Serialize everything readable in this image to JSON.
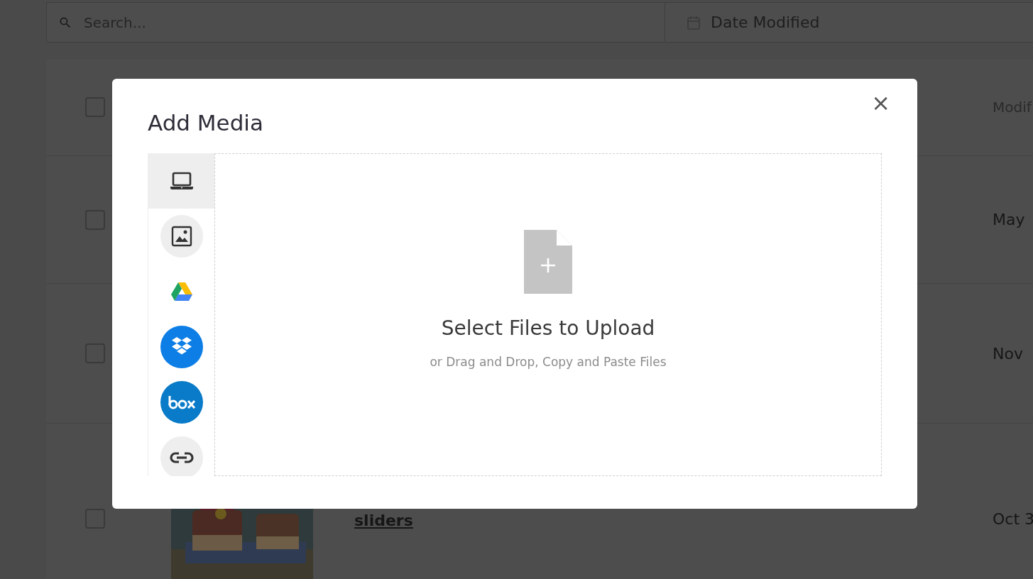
{
  "search": {
    "placeholder": "Search..."
  },
  "date_filter": {
    "label": "Date Modified"
  },
  "table": {
    "header": {
      "checked": false,
      "column_2": "Modif"
    },
    "rows": [
      {
        "checked": false,
        "date": "May"
      },
      {
        "checked": false,
        "date": "Nov"
      },
      {
        "checked": false,
        "title": "sliders",
        "date": "Oct 3"
      }
    ]
  },
  "modal": {
    "title": "Add Media",
    "close": "×",
    "sources": [
      {
        "kind": "device",
        "selected": true
      },
      {
        "kind": "images",
        "selected": false
      },
      {
        "kind": "drive",
        "selected": false
      },
      {
        "kind": "dropbox",
        "selected": false
      },
      {
        "kind": "box",
        "selected": false
      },
      {
        "kind": "link",
        "selected": false
      }
    ],
    "dropzone": {
      "title": "Select Files to Upload",
      "subtitle": "or Drag and Drop, Copy and Paste Files"
    }
  }
}
